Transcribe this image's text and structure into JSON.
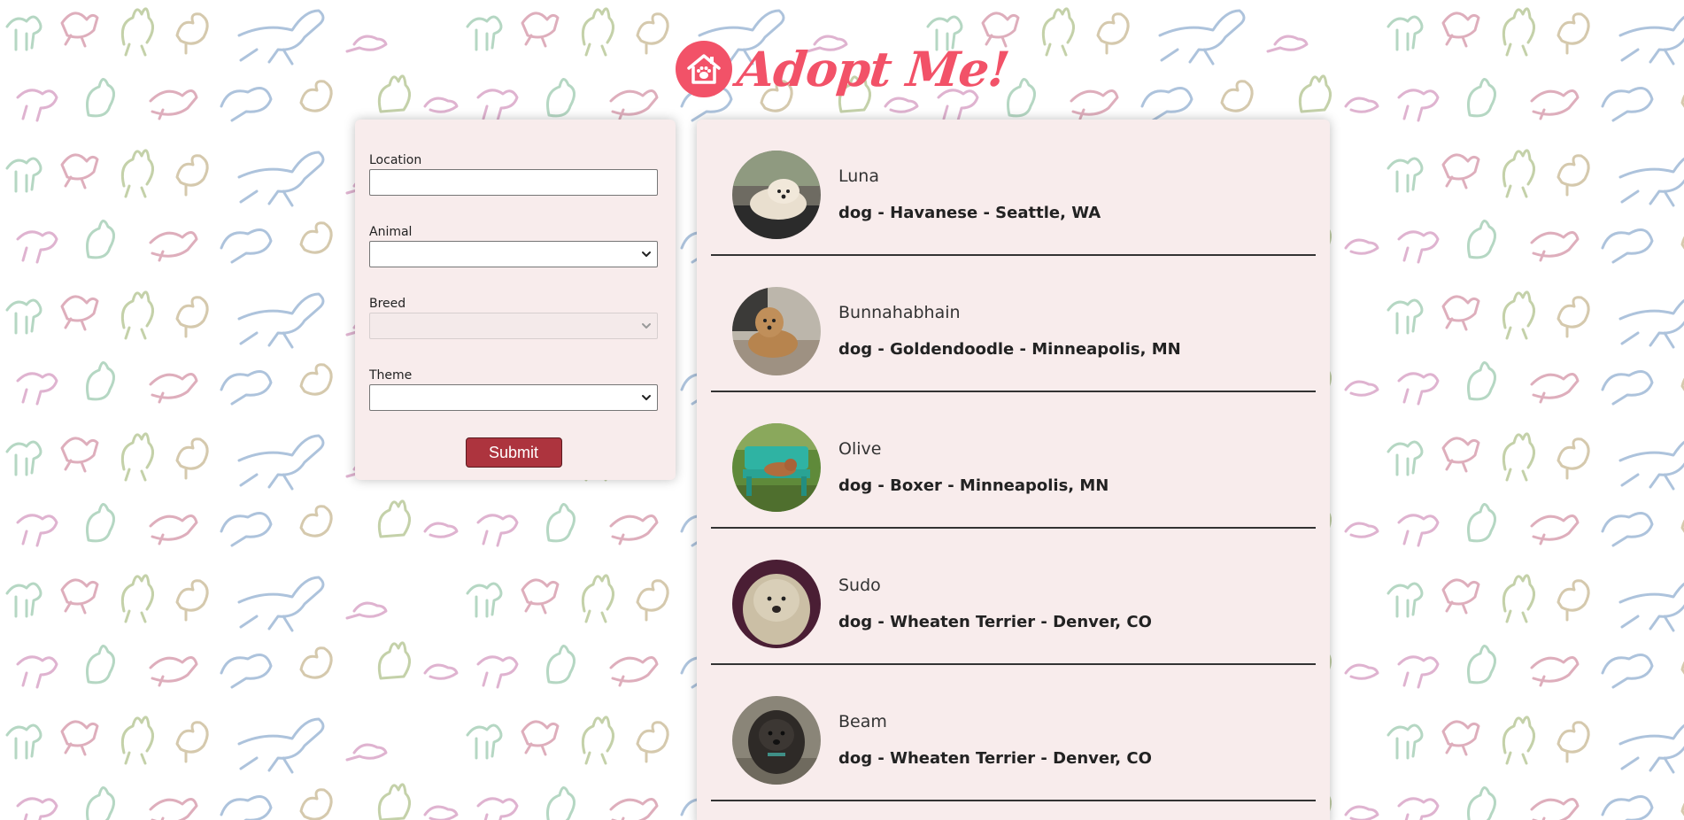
{
  "app": {
    "logo_text": "Adopt Me!",
    "logo_icon": "house-paw-icon",
    "brand_color": "#f25268"
  },
  "search": {
    "location_label": "Location",
    "location_value": "",
    "animal_label": "Animal",
    "animal_value": "",
    "breed_label": "Breed",
    "breed_value": "",
    "theme_label": "Theme",
    "theme_value": "",
    "submit_label": "Submit",
    "submit_color": "#ad343e"
  },
  "results": {
    "pets": [
      {
        "name": "Luna",
        "description": "dog - Havanese - Seattle, WA"
      },
      {
        "name": "Bunnahabhain",
        "description": "dog - Goldendoodle - Minneapolis, MN"
      },
      {
        "name": "Olive",
        "description": "dog - Boxer - Minneapolis, MN"
      },
      {
        "name": "Sudo",
        "description": "dog - Wheaten Terrier - Denver, CO"
      },
      {
        "name": "Beam",
        "description": "dog - Wheaten Terrier - Denver, CO"
      }
    ]
  },
  "background": {
    "pattern_colors": [
      "#9fb8d6",
      "#d9a6c8",
      "#a8d0b8",
      "#cdbf9e",
      "#d8a0b0",
      "#b9c99a"
    ]
  }
}
